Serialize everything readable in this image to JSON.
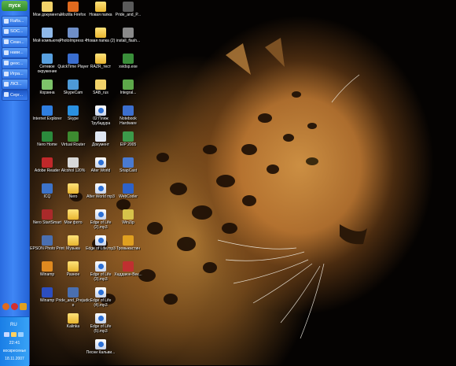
{
  "taskbar": {
    "start_label": "пуск",
    "buttons": [
      {
        "label": "Rafts...",
        "icon": "window-icon"
      },
      {
        "label": "SOC...",
        "icon": "window-icon"
      },
      {
        "label": "Сеан...",
        "icon": "window-icon"
      },
      {
        "label": "нави...",
        "icon": "window-icon"
      },
      {
        "label": "geoc...",
        "icon": "window-icon"
      },
      {
        "label": "Игра...",
        "icon": "window-icon"
      },
      {
        "label": "ЛКЗ...",
        "icon": "window-icon"
      },
      {
        "label": "Серг...",
        "icon": "window-icon"
      }
    ],
    "quick_launch": [
      "firefox-icon",
      "opera-icon",
      "winamp-icon"
    ]
  },
  "tray": {
    "language": "RU",
    "time": "22:41",
    "day": "воскресенье",
    "date": "18.11.2007"
  },
  "desktop_icons": [
    {
      "label": "Мои документы",
      "icon": "my-documents-icon",
      "col": 0,
      "row": 0,
      "color": "#f2d36a"
    },
    {
      "label": "Мой компьютер",
      "icon": "my-computer-icon",
      "col": 0,
      "row": 1,
      "color": "#8fb8e8"
    },
    {
      "label": "Сетевое окружение",
      "icon": "network-icon",
      "col": 0,
      "row": 2,
      "color": "#58a0e0"
    },
    {
      "label": "Корзина",
      "icon": "recycle-bin-icon",
      "col": 0,
      "row": 3,
      "color": "#7dc36a"
    },
    {
      "label": "Internet Explorer",
      "icon": "internet-explorer-icon",
      "col": 0,
      "row": 4,
      "color": "#2f7ee0"
    },
    {
      "label": "Nero Home",
      "icon": "nero-icon",
      "col": 0,
      "row": 5,
      "color": "#2b8a3c"
    },
    {
      "label": "Adobe Reader",
      "icon": "adobe-reader-icon",
      "col": 0,
      "row": 6,
      "color": "#c0282a"
    },
    {
      "label": "ICQ",
      "icon": "icq-icon",
      "col": 0,
      "row": 7,
      "color": "#3d73c9"
    },
    {
      "label": "Nero StartSmart",
      "icon": "nero-startsmart-icon",
      "col": 0,
      "row": 8,
      "color": "#aa2a2a"
    },
    {
      "label": "EPSON Photo Print",
      "icon": "epson-icon",
      "col": 0,
      "row": 9,
      "color": "#4a6fb0"
    },
    {
      "label": "Winamp",
      "icon": "winamp-icon",
      "col": 0,
      "row": 10,
      "color": "#e08a20"
    },
    {
      "label": "Winamp",
      "icon": "winamp-icon",
      "col": 0,
      "row": 11,
      "color": "#2c4ec0"
    },
    {
      "label": "Mozilla Firefox",
      "icon": "firefox-icon",
      "col": 1,
      "row": 0,
      "color": "#e06a1e"
    },
    {
      "label": "PhotoImpress 4",
      "icon": "photoimpression-icon",
      "col": 1,
      "row": 1,
      "color": "#6f8fc8"
    },
    {
      "label": "QuickTime Player",
      "icon": "quicktime-icon",
      "col": 1,
      "row": 2,
      "color": "#3a6ed0"
    },
    {
      "label": "SkypeCam",
      "icon": "skypecam-icon",
      "col": 1,
      "row": 3,
      "color": "#4d9ad8"
    },
    {
      "label": "Skype",
      "icon": "skype-icon",
      "col": 1,
      "row": 4,
      "color": "#2a90e0"
    },
    {
      "label": "Virtual Router",
      "icon": "router-icon",
      "col": 1,
      "row": 5,
      "color": "#3d8a30"
    },
    {
      "label": "Alcohol 120%",
      "icon": "alcohol-icon",
      "col": 1,
      "row": 6,
      "color": "#d8d8d8"
    },
    {
      "label": "Nero",
      "icon": "folder-icon",
      "col": 1,
      "row": 7,
      "color": "#f2d36a"
    },
    {
      "label": "Мои фото",
      "icon": "folder-icon",
      "col": 1,
      "row": 8,
      "color": "#f2d36a"
    },
    {
      "label": "Музыка",
      "icon": "folder-icon",
      "col": 1,
      "row": 9,
      "color": "#f2d36a"
    },
    {
      "label": "Разное",
      "icon": "folder-icon",
      "col": 1,
      "row": 10,
      "color": "#f2d36a"
    },
    {
      "label": "Pride_and_Prejudice",
      "icon": "video-icon",
      "col": 1,
      "row": 11,
      "color": "#4a6fb0"
    },
    {
      "label": "Kalinka",
      "icon": "folder-icon",
      "col": 1,
      "row": 12,
      "color": "#f2d36a"
    },
    {
      "label": "Новая папка",
      "icon": "folder-icon",
      "col": 2,
      "row": 0,
      "color": "#f2d36a"
    },
    {
      "label": "Новая папка (2)",
      "icon": "folder-icon",
      "col": 2,
      "row": 1,
      "color": "#f2d36a"
    },
    {
      "label": "RAZR_тест",
      "icon": "folder-icon",
      "col": 2,
      "row": 2,
      "color": "#f2d36a"
    },
    {
      "label": "SAB_rus",
      "icon": "sab-icon",
      "col": 2,
      "row": 3,
      "color": "#f2d36a"
    },
    {
      "label": "02 Пляж Трубадура",
      "icon": "mp3-icon",
      "col": 2,
      "row": 4,
      "color": "#dfe6f2"
    },
    {
      "label": "Документ",
      "icon": "document-icon",
      "col": 2,
      "row": 5,
      "color": "#dfe6f2"
    },
    {
      "label": "Alter World",
      "icon": "mp3-icon",
      "col": 2,
      "row": 6,
      "color": "#dfe6f2"
    },
    {
      "label": "Alter World mp3",
      "icon": "mp3-icon",
      "col": 2,
      "row": 7,
      "color": "#dfe6f2"
    },
    {
      "label": "Edge of Life (2).mp3",
      "icon": "mp3-icon",
      "col": 2,
      "row": 8,
      "color": "#dfe6f2"
    },
    {
      "label": "Edge of Life.mp3",
      "icon": "mp3-icon",
      "col": 2,
      "row": 9,
      "color": "#dfe6f2"
    },
    {
      "label": "Edge of Life (3).mp3",
      "icon": "mp3-icon",
      "col": 2,
      "row": 10,
      "color": "#dfe6f2"
    },
    {
      "label": "Edge of Life (4).mp3",
      "icon": "mp3-icon",
      "col": 2,
      "row": 11,
      "color": "#dfe6f2"
    },
    {
      "label": "Edge of Life (5).mp3",
      "icon": "mp3-icon",
      "col": 2,
      "row": 12,
      "color": "#dfe6f2"
    },
    {
      "label": "Песни Кальви...",
      "icon": "mp3-icon",
      "col": 2,
      "row": 13,
      "color": "#dfe6f2"
    },
    {
      "label": "Pride_and_P...",
      "icon": "video-icon",
      "col": 3,
      "row": 0,
      "color": "#5a5a5a"
    },
    {
      "label": "install_flash...",
      "icon": "installer-icon",
      "col": 3,
      "row": 1,
      "color": "#8a8a8a"
    },
    {
      "label": "xvidsp.exe",
      "icon": "exe-icon",
      "col": 3,
      "row": 2,
      "color": "#3a8f3a"
    },
    {
      "label": "Integral...",
      "icon": "integral-icon",
      "col": 3,
      "row": 3,
      "color": "#5da84a"
    },
    {
      "label": "Notebook Hardware",
      "icon": "notebook-icon",
      "col": 3,
      "row": 4,
      "color": "#3c6fcf"
    },
    {
      "label": "EIP 2005",
      "icon": "eip-icon",
      "col": 3,
      "row": 5,
      "color": "#3c9a4a"
    },
    {
      "label": "SnapCast",
      "icon": "snapcast-icon",
      "col": 3,
      "row": 6,
      "color": "#4a7ad0"
    },
    {
      "label": "WebCoder",
      "icon": "webcoder-icon",
      "col": 3,
      "row": 7,
      "color": "#2e62c8"
    },
    {
      "label": "WinZip",
      "icon": "winzip-icon",
      "col": 3,
      "row": 8,
      "color": "#d6c24a"
    },
    {
      "label": "Тровыкастин",
      "icon": "app-icon",
      "col": 3,
      "row": 9,
      "color": "#e0a020"
    },
    {
      "label": "Хаддаюн-Век...",
      "icon": "game-icon",
      "col": 3,
      "row": 10,
      "color": "#c03030"
    }
  ]
}
